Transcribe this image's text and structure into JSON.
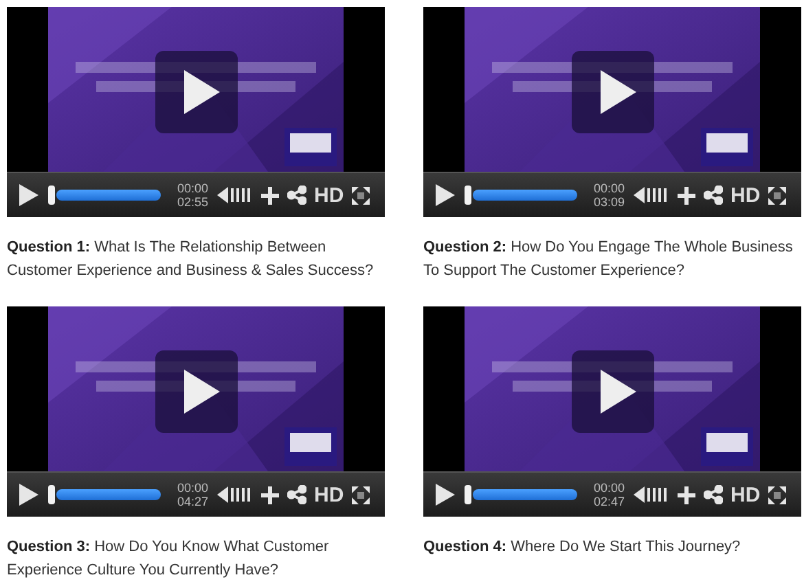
{
  "videos": [
    {
      "elapsed": "00:00",
      "duration": "02:55",
      "quality": "HD",
      "caption": "**Question 1:** What Is The Relationship Between Customer Experience and Business & Sales Success?"
    },
    {
      "elapsed": "00:00",
      "duration": "03:09",
      "quality": "HD",
      "caption": "**Question 2:** How Do You Engage The Whole Business To Support The Customer Experience?"
    },
    {
      "elapsed": "00:00",
      "duration": "04:27",
      "quality": "HD",
      "caption": "**Question 3:** How Do You Know What Customer Experience Culture You Currently Have?"
    },
    {
      "elapsed": "00:00",
      "duration": "02:47",
      "quality": "HD",
      "caption": "**Question 4:** Where Do We Start This Journey?"
    }
  ]
}
